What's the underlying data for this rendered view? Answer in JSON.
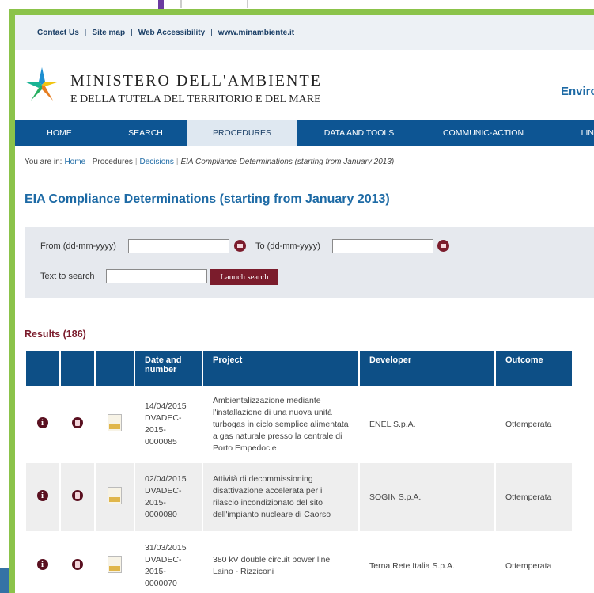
{
  "toplinks": [
    "Contact Us",
    "Site map",
    "Web Accessibility",
    "www.minambiente.it"
  ],
  "header": {
    "line1": "MINISTERO DELL'AMBIENTE",
    "line2": "E DELLA TUTELA DEL TERRITORIO E DEL MARE",
    "right": "Enviro"
  },
  "nav": [
    "HOME",
    "SEARCH",
    "PROCEDURES",
    "DATA AND TOOLS",
    "COMMUNIC-ACTION",
    "LIN"
  ],
  "breadcrumb": {
    "prefix": "You are in:",
    "home": "Home",
    "procedures": "Procedures",
    "decisions": "Decisions",
    "current": "EIA Compliance Determinations (starting from January 2013)"
  },
  "title": "EIA Compliance Determinations (starting from January 2013)",
  "form": {
    "from_label": "From (dd-mm-yyyy)",
    "to_label": "To (dd-mm-yyyy)",
    "text_label": "Text to search",
    "launch": "Launch search"
  },
  "results_label": "Results (186)",
  "table": {
    "headers": [
      "Date and number",
      "Project",
      "Developer",
      "Outcome"
    ],
    "rows": [
      {
        "date": "14/04/2015",
        "number": "DVADEC-2015-0000085",
        "project": "Ambientalizzazione mediante l'installazione di una nuova unità turbogas in ciclo semplice alimentata a gas naturale presso la centrale di Porto Empedocle",
        "developer": "ENEL S.p.A.",
        "outcome": "Ottemperata"
      },
      {
        "date": "02/04/2015",
        "number": "DVADEC-2015-0000080",
        "project": "Attività di decommissioning disattivazione accelerata per il rilascio incondizionato del sito dell'impianto nucleare di Caorso",
        "developer": "SOGIN S.p.A.",
        "outcome": "Ottemperata"
      },
      {
        "date": "31/03/2015",
        "number": "DVADEC-2015-0000070",
        "project": "380 kV double circuit power line Laino - Rizziconi",
        "developer": "Terna Rete Italia S.p.A.",
        "outcome": "Ottemperata"
      }
    ]
  },
  "colors": {
    "frame": "#8bc34a",
    "nav": "#0d5593",
    "title": "#1d6aa5",
    "accent": "#7b1c2c"
  },
  "icons": [
    "info-icon",
    "document-icon",
    "pdf-icon",
    "calendar-icon"
  ]
}
